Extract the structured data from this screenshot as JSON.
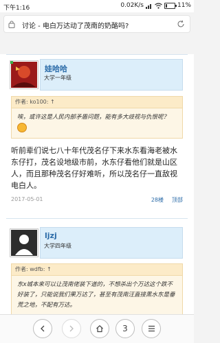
{
  "status_bar": {
    "time": "下午1:16",
    "network_speed": "0.02K/s",
    "battery": "11%"
  },
  "address_bar": {
    "title": "讨论 - 电白万达动了茂南的奶酪吗?"
  },
  "posts": [
    {
      "username": "娃哈哈",
      "grade": "大学一年级",
      "quote_author": "作者: ko100: ↑",
      "quote_text": "唉，或许这是人民内部矛盾问题，能有多大歧视与仇恨呢？",
      "body": "听前辈们说七八十年代茂名仔下来水东看海老被水东仔打，茂名设地级市前，水东仔看他们就是山区人，而且那种茂名仔好难听，所以茂名仔一直敌视电白人。",
      "date": "2017-05-01",
      "floor": "28楼",
      "top_link": "顶部"
    },
    {
      "username": "ljzj",
      "grade": "大学四年级",
      "quote_author": "作者: wdfb: ↑",
      "quote_text": "东x城本来可以让茂南佬装下道的，不想杀出个万达这个跌不好装了，只能说我们果万达了，甚至有茂南汪直接黑水东是垂荒之地，不配有万达。"
    }
  ],
  "bottom_bar": {
    "tab_count": "3"
  },
  "colors": {
    "link_blue": "#2b6ba8",
    "userbar_bg": "#dceefa",
    "quote_bg": "#fdf6e6"
  }
}
